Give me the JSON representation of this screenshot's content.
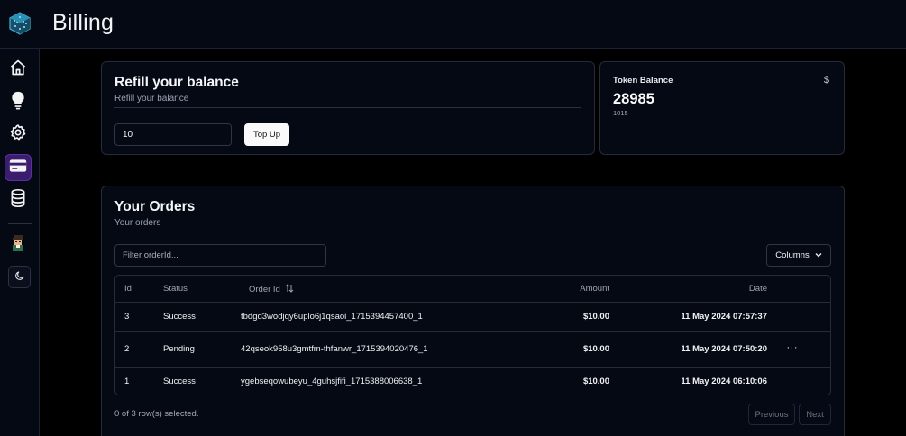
{
  "header": {
    "title": "Billing",
    "logo_icon": "cube-logo-icon"
  },
  "sidebar": {
    "items": [
      {
        "name": "home",
        "icon": "home-icon",
        "active": false
      },
      {
        "name": "ideas",
        "icon": "lightbulb-icon",
        "active": false
      },
      {
        "name": "settings",
        "icon": "gear-icon",
        "active": false
      },
      {
        "name": "billing",
        "icon": "credit-card-icon",
        "active": true
      },
      {
        "name": "database",
        "icon": "database-icon",
        "active": false
      }
    ],
    "avatar_icon": "avatar-icon",
    "theme_icon": "moon-icon",
    "active_color": "#3b1d6e"
  },
  "refill": {
    "title": "Refill your balance",
    "subtitle": "Refill your balance",
    "amount_value": "10",
    "topup_label": "Top Up"
  },
  "token": {
    "label": "Token Balance",
    "currency_symbol": "$",
    "value": "28985",
    "secondary": "1015"
  },
  "orders": {
    "title": "Your Orders",
    "subtitle": "Your orders",
    "filter_placeholder": "Filter orderId...",
    "columns_label": "Columns",
    "headers": {
      "id": "Id",
      "status": "Status",
      "order_id": "Order Id",
      "amount": "Amount",
      "date": "Date"
    },
    "rows": [
      {
        "id": "3",
        "status": "Success",
        "order_id": "tbdgd3wodjqy6uplo6j1qsaoi_1715394457400_1",
        "amount": "$10.00",
        "date": "11 May 2024 07:57:37"
      },
      {
        "id": "2",
        "status": "Pending",
        "order_id": "42qseok958u3gmtfm-thfanwr_1715394020476_1",
        "amount": "$10.00",
        "date": "11 May 2024 07:50:20",
        "menu": "···"
      },
      {
        "id": "1",
        "status": "Success",
        "order_id": "ygebseqowubeyu_4guhsjfifi_1715388006638_1",
        "amount": "$10.00",
        "date": "11 May 2024 06:10:06"
      }
    ],
    "selected_text": "0 of 3 row(s) selected.",
    "previous_label": "Previous",
    "next_label": "Next"
  }
}
